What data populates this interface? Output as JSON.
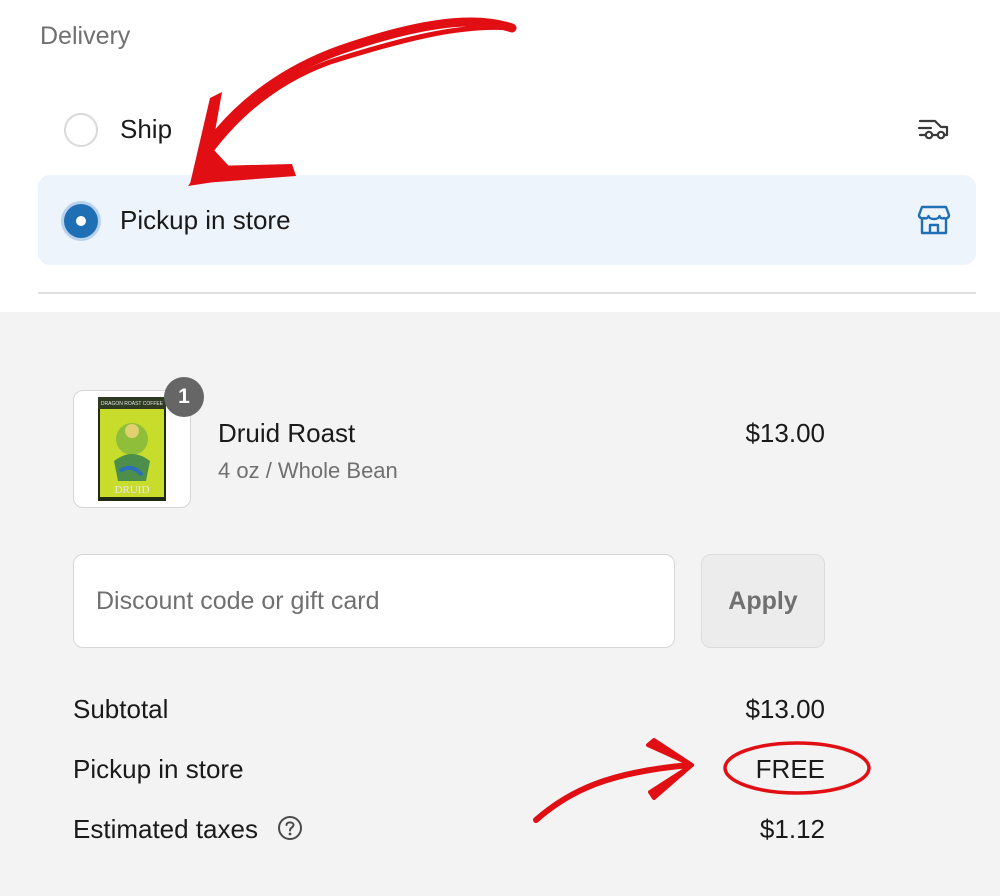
{
  "delivery": {
    "title": "Delivery",
    "options": [
      {
        "label": "Ship",
        "icon": "truck-icon",
        "selected": false
      },
      {
        "label": "Pickup in store",
        "icon": "store-icon",
        "selected": true
      }
    ]
  },
  "product": {
    "quantity": "1",
    "name": "Druid Roast",
    "variant": "4 oz / Whole Bean",
    "price": "$13.00",
    "image": {
      "brand_text": "DRAGON ROAST COFFEE",
      "name_text": "DRUID"
    }
  },
  "discount": {
    "placeholder": "Discount code or gift card",
    "value": "",
    "apply_label": "Apply"
  },
  "totals": {
    "subtotal_label": "Subtotal",
    "subtotal_value": "$13.00",
    "shipping_label": "Pickup in store",
    "shipping_value": "FREE",
    "taxes_label": "Estimated taxes",
    "taxes_value": "$1.12"
  },
  "colors": {
    "accent": "#1f6fb5",
    "annotation": "#e10f14",
    "selected_bg": "#eef4fc",
    "summary_bg": "#f3f3f3"
  }
}
